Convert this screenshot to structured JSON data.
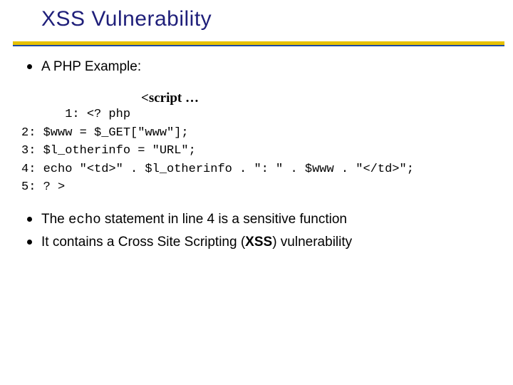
{
  "title": "XSS Vulnerability",
  "top_bullets": [
    "A PHP Example:"
  ],
  "code_annotation": "<script …",
  "code_lines": [
    "1: <? php",
    "2: $www = $_GET[\"www\"];",
    "3: $l_otherinfo = \"URL\";",
    "4: echo \"<td>\" . $l_otherinfo . \": \" . $www . \"</td>\";",
    "5: ? >"
  ],
  "bottom_bullets": [
    {
      "pre": "The ",
      "code": "echo",
      "post": " statement in line 4 is a sensitive function"
    },
    {
      "text": "It contains a Cross Site Scripting (",
      "bold": "XSS",
      "after": ") vulnerability"
    }
  ]
}
